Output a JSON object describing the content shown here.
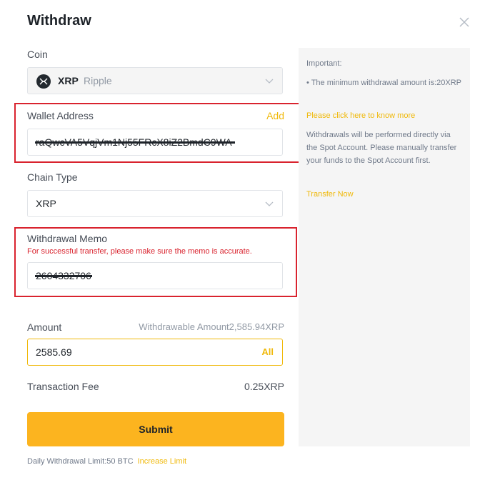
{
  "dialog": {
    "title": "Withdraw"
  },
  "coin": {
    "label": "Coin",
    "code": "XRP",
    "name": "Ripple"
  },
  "wallet": {
    "label": "Wallet Address",
    "add_label": "Add",
    "value": "raQwcVA5VqjVm1Nj55FRcX8iZ2BmdC9WA"
  },
  "chain": {
    "label": "Chain Type",
    "value": "XRP"
  },
  "memo": {
    "label": "Withdrawal Memo",
    "warning": "For successful transfer, please make sure the memo is accurate.",
    "value": "2604332706"
  },
  "amount": {
    "label": "Amount",
    "withdrawable": "Withdrawable Amount2,585.94XRP",
    "value": "2585.69",
    "all_label": "All"
  },
  "fee": {
    "label": "Transaction Fee",
    "value": "0.25XRP"
  },
  "submit": {
    "label": "Submit"
  },
  "limit": {
    "text": "Daily Withdrawal Limit:50 BTC",
    "link": "Increase Limit"
  },
  "info_panel": {
    "heading": "Important:",
    "min_text": "• The minimum withdrawal amount is:20XRP",
    "know_more": "Please click here to know more",
    "spot_text": "Withdrawals will be performed directly via the Spot Account. Please manually transfer your funds to the Spot Account first.",
    "transfer_now": "Transfer Now"
  },
  "colors": {
    "accent": "#f0b90b",
    "button": "#fcb41f",
    "warning": "#d9232e",
    "highlight_box": "#d9232e"
  }
}
